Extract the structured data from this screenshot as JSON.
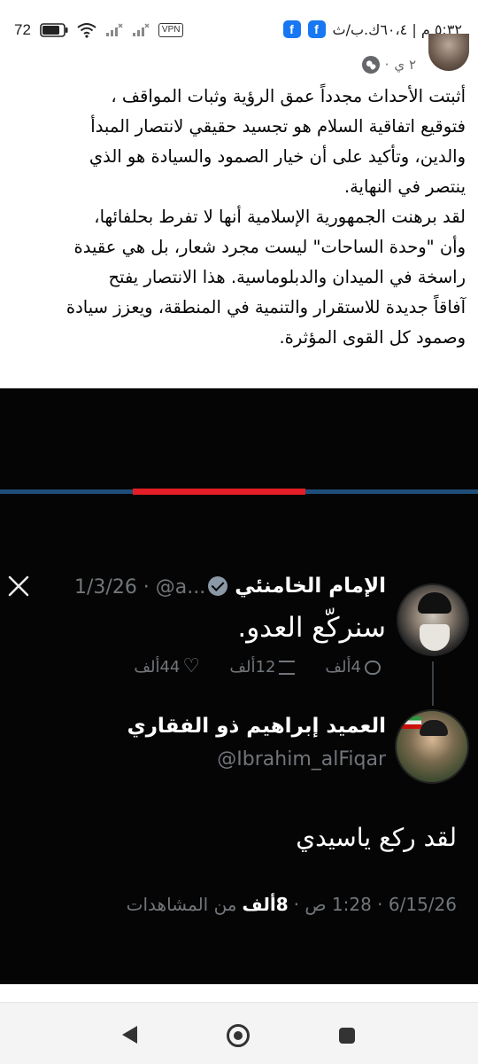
{
  "status_bar": {
    "time": "٥:٣٢ م | ٦٠،٤ك.ب/ث",
    "battery": "72",
    "vpn_label": "VPN",
    "app_badges": [
      "f",
      "f"
    ]
  },
  "post": {
    "time_ago": "٢ ي",
    "privacy_icon": "globe-icon",
    "paragraphs": [
      "أثبتت الأحداث مجدداً عمق الرؤية وثبات المواقف ،\nفتوقيع اتفاقية السلام هو تجسيد حقيقي لانتصار المبدأ\nوالدين، وتأكيد على أن خيار الصمود والسيادة هو الذي\nينتصر في النهاية.",
      "لقد برهنت الجمهورية الإسلامية أنها لا تفرط بحلفائها،\nوأن \"وحدة الساحات\" ليست مجرد شعار، بل هي عقيدة\nراسخة في الميدان والدبلوماسية. هذا الانتصار يفتح\nآفاقاً جديدة للاستقرار والتنمية في المنطقة، ويعزز سيادة\nوصمود كل القوى المؤثرة."
    ]
  },
  "embed": {
    "colors": {
      "background": "#050505",
      "accent_red": "#e41e26",
      "accent_blue": "#1f4f78"
    },
    "tweet1": {
      "name": "الإمام الخامنئي",
      "handle_date": "1/3/26 · @a...",
      "text": "سنركّع العدو.",
      "replies": "4ألف",
      "retweets": "12ألف",
      "likes": "44ألف"
    },
    "tweet2": {
      "name": "العميد إبراهيم ذو الفقاري",
      "handle": "@Ibrahim_alFiqar",
      "text": "لقد ركع ياسيدي",
      "date_time": "6/15/26 · 1:28 ص ·",
      "views_count": "8ألف",
      "views_label": "من المشاهدات"
    }
  },
  "nav": {
    "back": "back-icon",
    "home": "home-icon",
    "recents": "recents-icon"
  }
}
